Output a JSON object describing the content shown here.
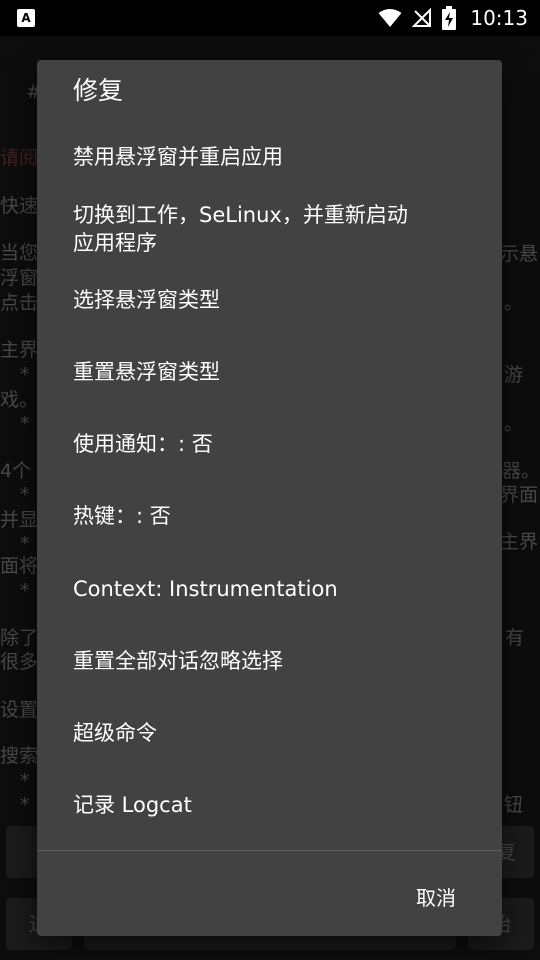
{
  "status_bar": {
    "app_icon": "A",
    "time": "10:13",
    "icons": [
      "wifi-icon",
      "no-signal-icon",
      "battery-charging-icon"
    ]
  },
  "background": {
    "lines": [
      "#",
      "请阅",
      "快速",
      "当您",
      "浮窗",
      "点击",
      "主界",
      "*",
      "戏。",
      "*",
      "4个",
      "*",
      "并显",
      "*",
      "面将",
      "*",
      "除了",
      "很多",
      "设置",
      "搜索",
      "*",
      "*"
    ],
    "right_fragments": [
      "示悬",
      "。",
      "游",
      "。",
      "器。",
      "界面",
      "主界",
      "有",
      "钮"
    ],
    "buttons": {
      "bottom_right_top": "复",
      "bottom_left": "退",
      "bottom_right": "始"
    }
  },
  "dialog": {
    "title": "修复",
    "items": [
      "禁用悬浮窗并重启应用",
      "切换到工作，SeLinux，并重新启动\n应用程序",
      "选择悬浮窗类型",
      "重置悬浮窗类型",
      "使用通知：: 否",
      "热键：: 否",
      "Context: Instrumentation",
      "重置全部对话忽略选择",
      "超级命令",
      "记录 Logcat"
    ],
    "cancel": "取消"
  }
}
